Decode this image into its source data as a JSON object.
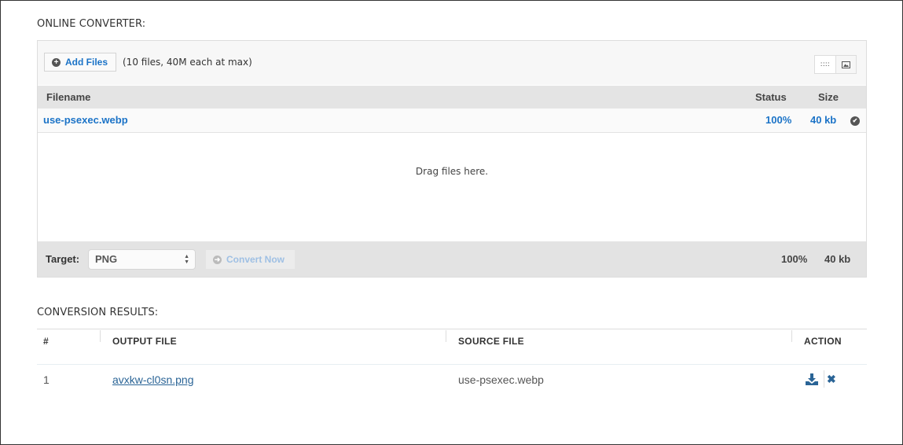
{
  "converter": {
    "title": "ONLINE CONVERTER:",
    "add_files_label": "Add Files",
    "limit_text": "(10 files, 40M each at max)",
    "view_icons": [
      "list-view-icon",
      "thumbnail-view-icon"
    ],
    "columns": {
      "filename": "Filename",
      "status": "Status",
      "size": "Size"
    },
    "files": [
      {
        "name": "use-psexec.webp",
        "status": "100%",
        "size": "40 kb",
        "state_icon": "check-circle-icon"
      }
    ],
    "drop_text": "Drag files here.",
    "target_label": "Target:",
    "target_value": "PNG",
    "convert_label": "Convert Now",
    "total_status": "100%",
    "total_size": "40 kb"
  },
  "results": {
    "title": "CONVERSION RESULTS:",
    "columns": {
      "num": "#",
      "output": "OUTPUT FILE",
      "source": "SOURCE FILE",
      "action": "ACTION"
    },
    "rows": [
      {
        "num": "1",
        "output": "avxkw-cl0sn.png",
        "source": "use-psexec.webp",
        "actions": [
          "download-icon",
          "delete-icon"
        ]
      }
    ]
  },
  "colors": {
    "link_blue": "#1b73c7",
    "result_link": "#2a6496"
  }
}
